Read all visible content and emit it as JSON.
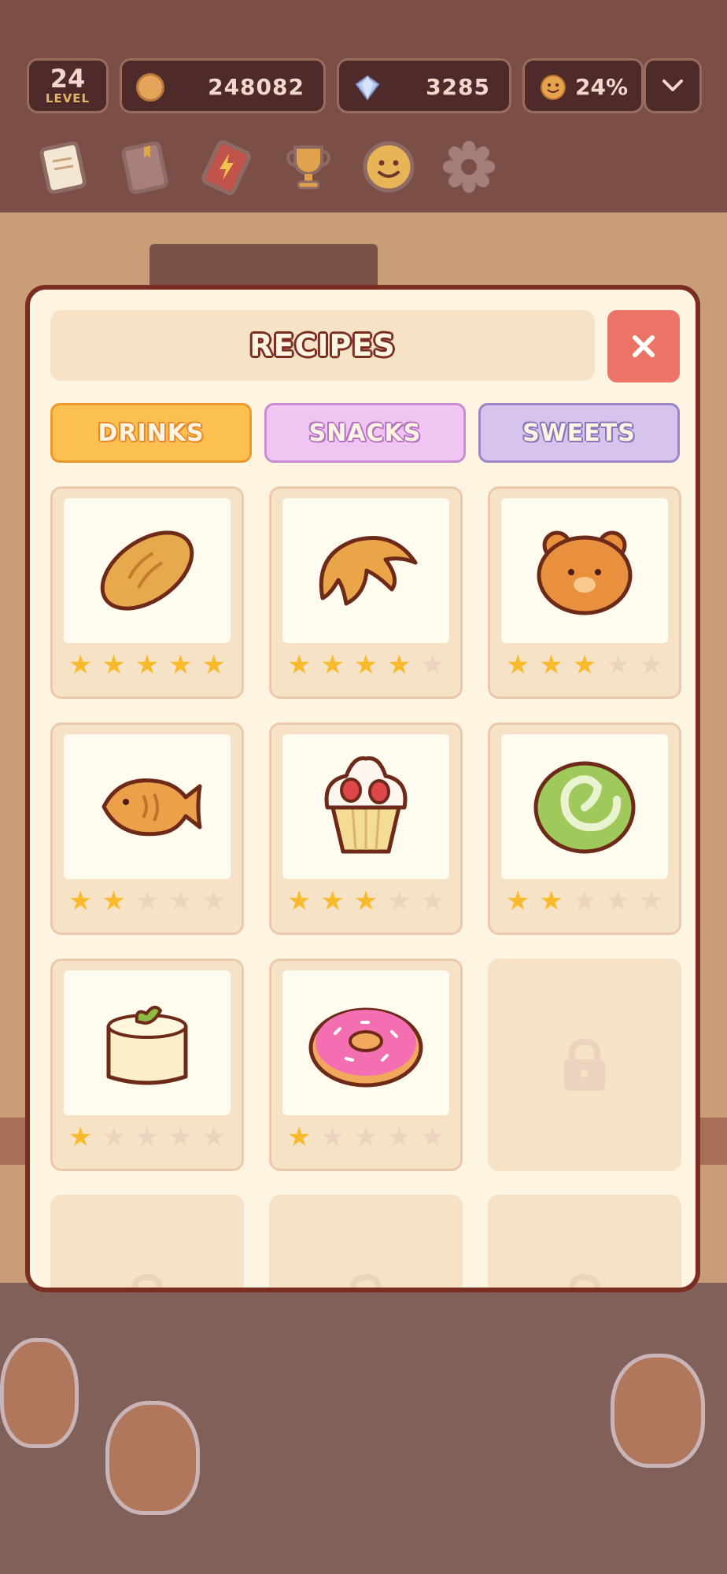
{
  "hud": {
    "level_number": "24",
    "level_label": "LEVEL",
    "coins": "248082",
    "gems": "3285",
    "mood": "24%"
  },
  "toolbar": {
    "icons": [
      "notepad-icon",
      "book-icon",
      "lightning-card-icon",
      "trophy-icon",
      "smiley-icon",
      "gear-icon"
    ]
  },
  "dialog": {
    "title": "RECIPES",
    "close_symbol": "✕",
    "tabs": [
      {
        "label": "DRINKS"
      },
      {
        "label": "SNACKS"
      },
      {
        "label": "SWEETS"
      }
    ],
    "active_tab": "DRINKS",
    "recipes": [
      {
        "item": "bread",
        "stars": 5,
        "locked": false
      },
      {
        "item": "croissant",
        "stars": 4,
        "locked": false
      },
      {
        "item": "bear-bun",
        "stars": 3,
        "locked": false
      },
      {
        "item": "taiyaki",
        "stars": 2,
        "locked": false
      },
      {
        "item": "strawberry-cupcake",
        "stars": 3,
        "locked": false
      },
      {
        "item": "matcha-roll",
        "stars": 2,
        "locked": false
      },
      {
        "item": "cheesecake",
        "stars": 1,
        "locked": false
      },
      {
        "item": "pink-donut",
        "stars": 1,
        "locked": false
      },
      {
        "item": "",
        "stars": 0,
        "locked": true
      },
      {
        "item": "",
        "stars": 0,
        "locked": true
      },
      {
        "item": "",
        "stars": 0,
        "locked": true
      },
      {
        "item": "",
        "stars": 0,
        "locked": true
      }
    ],
    "max_stars": 5
  },
  "colors": {
    "star_on": "#f9bb2c",
    "star_off": "#ecd3bd",
    "close_button": "#ec7466",
    "dialog_border": "#7a2e22"
  }
}
